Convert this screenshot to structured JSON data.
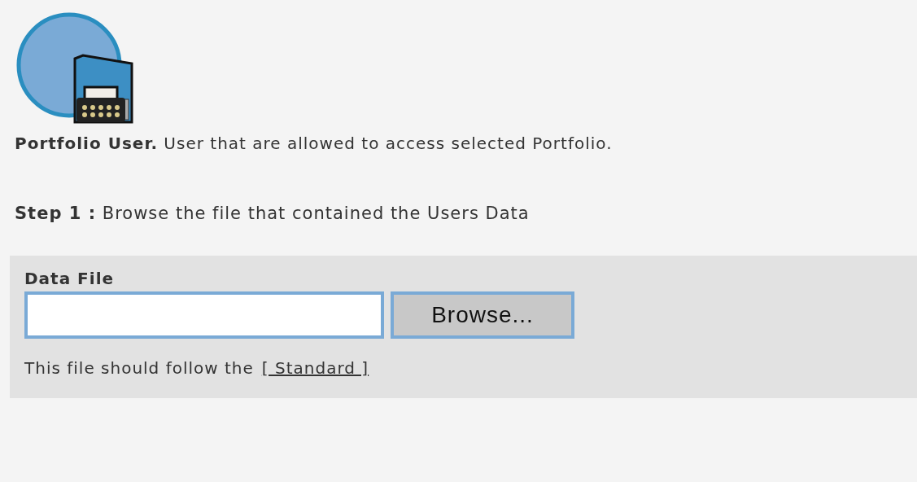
{
  "header": {
    "text": "**Portfolio User.** User that are allowed to access selected Portfolio."
  },
  "step": {
    "text": "**Step 1 :** Browse the file that contained the Users Data"
  },
  "form": {
    "label": "Data File",
    "button": "Browse...",
    "note": {
      "text": "This file should follow the",
      "link": "[ Standard ]"
    }
  }
}
